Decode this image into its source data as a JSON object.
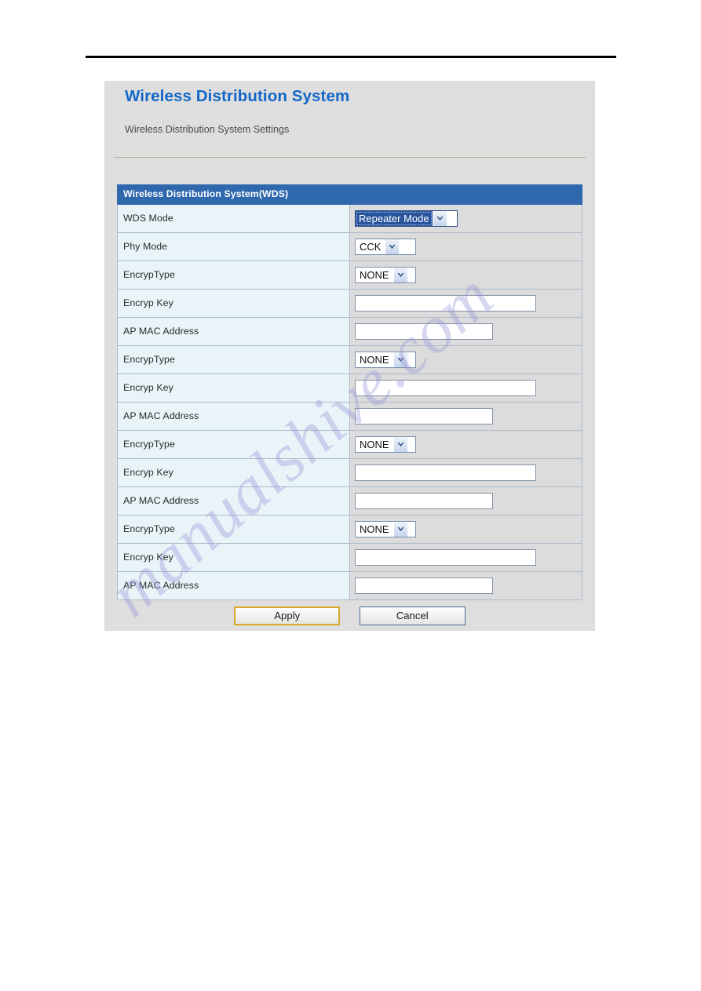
{
  "page": {
    "top_rule": true
  },
  "watermark": {
    "text": "manualshive.com"
  },
  "panel": {
    "title": "Wireless Distribution System",
    "subtitle": "Wireless Distribution System Settings"
  },
  "table": {
    "section_header": "Wireless Distribution System(WDS)",
    "rows": [
      {
        "label": "WDS Mode",
        "control": "select",
        "value": "Repeater Mode",
        "focused": true,
        "width_class": "sel-wds"
      },
      {
        "label": "Phy Mode",
        "control": "select",
        "value": "CCK",
        "focused": false,
        "width_class": "sel-phy"
      },
      {
        "label": "EncrypType",
        "control": "select",
        "value": "NONE",
        "focused": false,
        "width_class": "sel-enc"
      },
      {
        "label": "Encryp Key",
        "control": "text",
        "value": "",
        "width_class": "txt-key"
      },
      {
        "label": "AP MAC Address",
        "control": "text",
        "value": "",
        "width_class": "txt-mac"
      },
      {
        "label": "EncrypType",
        "control": "select",
        "value": "NONE",
        "focused": false,
        "width_class": "sel-enc"
      },
      {
        "label": "Encryp Key",
        "control": "text",
        "value": "",
        "width_class": "txt-key"
      },
      {
        "label": "AP MAC Address",
        "control": "text",
        "value": "",
        "width_class": "txt-mac"
      },
      {
        "label": "EncrypType",
        "control": "select",
        "value": "NONE",
        "focused": false,
        "width_class": "sel-enc"
      },
      {
        "label": "Encryp Key",
        "control": "text",
        "value": "",
        "width_class": "txt-key"
      },
      {
        "label": "AP MAC Address",
        "control": "text",
        "value": "",
        "width_class": "txt-mac"
      },
      {
        "label": "EncrypType",
        "control": "select",
        "value": "NONE",
        "focused": false,
        "width_class": "sel-enc"
      },
      {
        "label": "Encryp Key",
        "control": "text",
        "value": "",
        "width_class": "txt-key"
      },
      {
        "label": "AP MAC Address",
        "control": "text",
        "value": "",
        "width_class": "txt-mac"
      }
    ]
  },
  "buttons": {
    "apply_label": "Apply",
    "cancel_label": "Cancel"
  },
  "colors": {
    "title_blue": "#1367c8",
    "section_header_blue": "#2f68ad",
    "label_cell": "#e9f4f9",
    "value_cell": "#dcdcdc",
    "panel_bg": "#dedede",
    "apply_border_gold": "#d9a627",
    "cancel_border_blue": "#4b6a95",
    "select_focus_blue": "#29559c",
    "watermark_purple": "#9696d7"
  }
}
